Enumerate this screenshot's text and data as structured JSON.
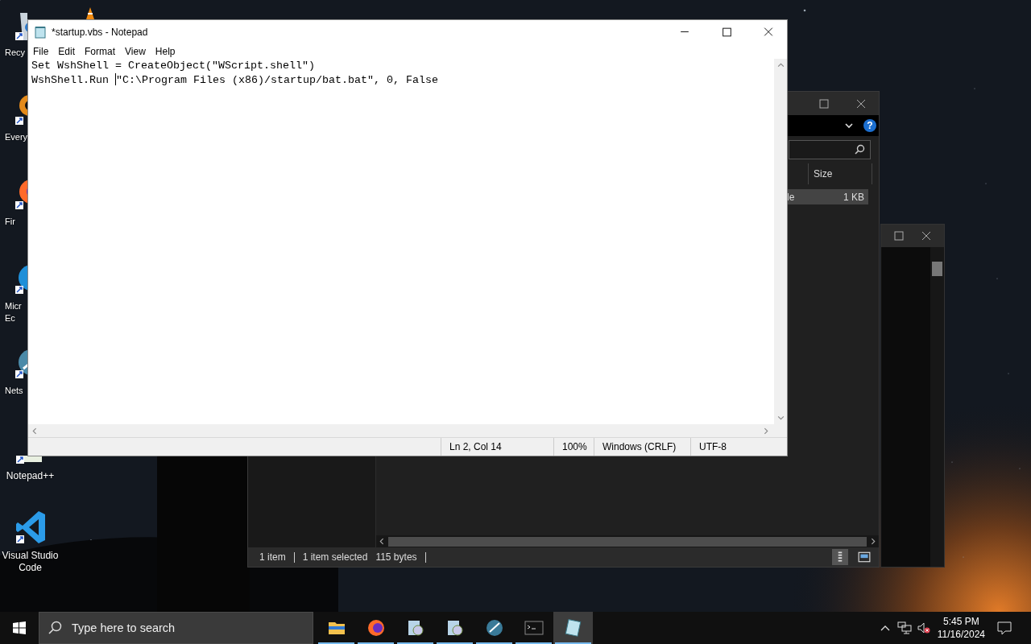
{
  "desktop_icons": [
    {
      "kind": "recycle-bin",
      "lines": [
        "Recy"
      ]
    },
    {
      "kind": "everything",
      "lines": [
        "Every"
      ]
    },
    {
      "kind": "firefox",
      "lines": [
        "Fir"
      ]
    },
    {
      "kind": "edge",
      "lines": [
        "Micr",
        "Ec"
      ]
    },
    {
      "kind": "netscape",
      "lines": [
        "Nets"
      ]
    },
    {
      "kind": "notepadpp",
      "lines": [
        "Notepad++"
      ]
    },
    {
      "kind": "vscode",
      "lines": [
        "Visual Studio",
        "Code"
      ]
    }
  ],
  "explorer": {
    "help": "?",
    "columns": [
      "Size"
    ],
    "rows": [
      {
        "column_1": "le",
        "size": "1 KB",
        "selected": true
      }
    ],
    "status": {
      "count": "1 item",
      "selection": "1 item selected",
      "size": "115 bytes"
    }
  },
  "notepad": {
    "title": "*startup.vbs - Notepad",
    "menu": [
      "File",
      "Edit",
      "Format",
      "View",
      "Help"
    ],
    "lines": [
      {
        "text": "Set WshShell = CreateObject(\"WScript.shell\")",
        "caret": false
      },
      {
        "text": "WshShell.Run ",
        "caret": true,
        "rest": "\"C:\\Program Files (x86)/startup/bat.bat\", 0, False"
      }
    ],
    "status_bar": [
      "Ln 2, Col 14",
      "100%",
      "Windows (CRLF)",
      "UTF-8"
    ]
  },
  "taskbar": {
    "search": {
      "placeholder": "Type here to search"
    },
    "apps": [
      {
        "kind": "folder",
        "running": true,
        "selected": false
      },
      {
        "kind": "firefox",
        "running": true,
        "selected": false
      },
      {
        "kind": "setup",
        "running": true,
        "selected": false
      },
      {
        "kind": "setup",
        "running": true,
        "selected": false
      },
      {
        "kind": "netscape",
        "running": true,
        "selected": false
      },
      {
        "kind": "terminal",
        "running": true,
        "selected": false
      },
      {
        "kind": "notepad",
        "running": true,
        "selected": true
      }
    ],
    "tray": {
      "muted": true,
      "time": "5:45 PM",
      "date": "11/16/2024"
    }
  }
}
